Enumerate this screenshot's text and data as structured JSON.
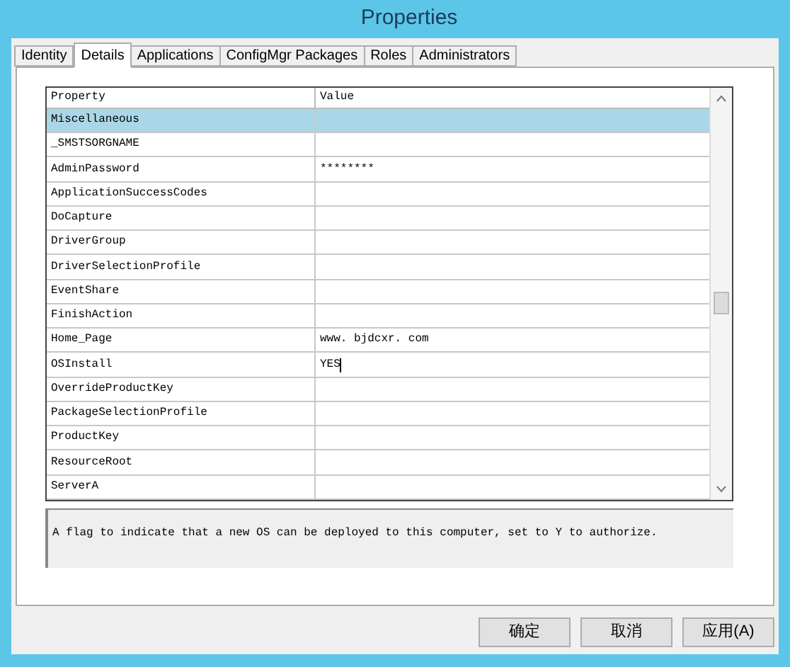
{
  "window": {
    "title": "Properties"
  },
  "tabs": [
    {
      "label": "Identity",
      "selected": false
    },
    {
      "label": "Details",
      "selected": true
    },
    {
      "label": "Applications",
      "selected": false
    },
    {
      "label": "ConfigMgr Packages",
      "selected": false
    },
    {
      "label": "Roles",
      "selected": false
    },
    {
      "label": "Administrators",
      "selected": false
    }
  ],
  "grid": {
    "columns": [
      "Property",
      "Value"
    ],
    "rows": [
      {
        "property": "Miscellaneous",
        "selected": true,
        "editing": false
      },
      {
        "property": "_SMSTSORGNAME",
        "selected": false,
        "editing": false
      },
      {
        "property": "AdminPassword",
        "value": "********",
        "selected": false,
        "editing": false
      },
      {
        "property": "ApplicationSuccessCodes",
        "selected": false,
        "editing": false
      },
      {
        "property": "DoCapture",
        "selected": false,
        "editing": false
      },
      {
        "property": "DriverGroup",
        "selected": false,
        "editing": false
      },
      {
        "property": "DriverSelectionProfile",
        "selected": false,
        "editing": false
      },
      {
        "property": "EventShare",
        "selected": false,
        "editing": false
      },
      {
        "property": "FinishAction",
        "selected": false,
        "editing": false
      },
      {
        "property": "Home_Page",
        "value": "www. bjdcxr. com",
        "selected": false,
        "editing": false
      },
      {
        "property": "OSInstall",
        "value": "YES",
        "selected": false,
        "editing": true
      },
      {
        "property": "OverrideProductKey",
        "selected": false,
        "editing": false
      },
      {
        "property": "PackageSelectionProfile",
        "selected": false,
        "editing": false
      },
      {
        "property": "ProductKey",
        "selected": false,
        "editing": false
      },
      {
        "property": "ResourceRoot",
        "selected": false,
        "editing": false
      },
      {
        "property": "ServerA",
        "selected": false,
        "editing": false
      }
    ]
  },
  "description": "A flag to indicate that a new OS can be deployed to this computer, set to Y to authorize.",
  "buttons": [
    "确定",
    "取消",
    "应用(A)"
  ]
}
